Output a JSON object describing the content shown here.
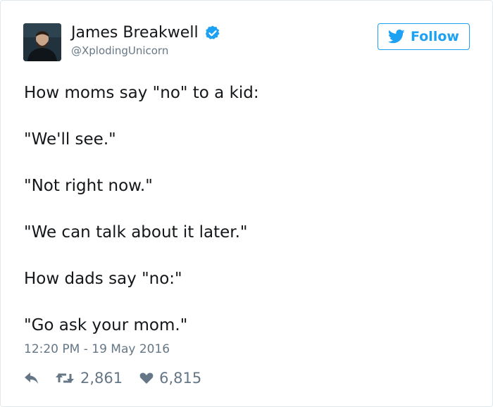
{
  "user": {
    "name": "James Breakwell",
    "handle": "@XplodingUnicorn"
  },
  "follow_button": {
    "label": "Follow"
  },
  "tweet": {
    "lines": [
      "How moms say \"no\" to a kid:",
      "\"We'll see.\"",
      "\"Not right now.\"",
      "\"We can talk about it later.\"",
      "How dads say \"no:\"",
      "\"Go ask your mom.\""
    ],
    "timestamp": "12:20 PM - 19 May 2016",
    "retweet_count": "2,861",
    "like_count": "6,815"
  },
  "icons": {
    "verified": "verified-badge-icon",
    "bird": "twitter-bird-icon",
    "reply": "reply-icon",
    "retweet": "retweet-icon",
    "like": "heart-icon"
  },
  "colors": {
    "accent": "#1da1f2",
    "text": "#14171a",
    "muted": "#657786",
    "border": "#e1e8ed"
  }
}
